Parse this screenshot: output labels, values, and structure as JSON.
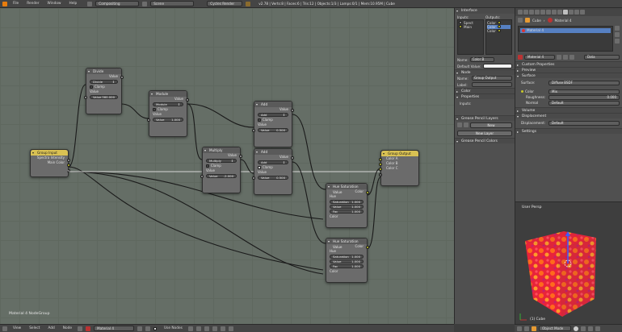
{
  "topbar": {
    "menus": [
      "File",
      "Render",
      "Window",
      "Help"
    ],
    "editor_type": "Compositing",
    "scene": "Scene",
    "engine": "Cycles Render",
    "stats": "v2.78 | Verts:8 | Faces:6 | Tris:12 | Objects:1/3 | Lamps:0/1 | Mem:10.95M | Cube"
  },
  "nodes": {
    "divide": {
      "title": "Divide",
      "output": "Value",
      "mode": "Divide",
      "clamp": "Clamp",
      "input": "Value",
      "value_label": "Value",
      "value": "360.000"
    },
    "module": {
      "title": "Module",
      "output": "Value",
      "mode": "Module",
      "clamp": "Clamp",
      "input": "Value",
      "value_label": "Value",
      "value": "1.000"
    },
    "multiply": {
      "title": "Multiply",
      "output": "Value",
      "mode": "Multiply",
      "clamp": "Clamp",
      "input": "Value",
      "value_label": "Value",
      "value": "-2.000"
    },
    "add1": {
      "title": "Add",
      "output": "Value",
      "mode": "Add",
      "clamp": "Clamp",
      "input": "Value",
      "value_label": "Value",
      "value": "0.500"
    },
    "add2": {
      "title": "Add",
      "output": "Value",
      "mode": "Add",
      "clamp": "Clamp",
      "input": "Value",
      "value_label": "Value",
      "value": "0.500"
    },
    "group_input": {
      "title": "Group Input",
      "out1": "Spectra Intensity",
      "out2": "Main Color"
    },
    "group_output": {
      "title": "Group Output",
      "in1": "Color A",
      "in2": "Color B",
      "in3": "Color C"
    },
    "hsv1": {
      "title": "Hue Saturation Value",
      "output": "Color",
      "hue": "Hue",
      "sat_label": "Saturation",
      "sat": "1.000",
      "val_label": "Value",
      "val": "1.000",
      "fac_label": "Fac",
      "fac": "1.000",
      "color": "Color"
    },
    "hsv2": {
      "title": "Hue Saturation Value",
      "output": "Color",
      "hue": "Hue",
      "sat_label": "Saturation",
      "sat": "1.000",
      "val_label": "Value",
      "val": "1.000",
      "fac_label": "Fac",
      "fac": "1.000",
      "color": "Color"
    }
  },
  "editor_label": "Material 4 NodeGroup",
  "bottombar": {
    "menus": [
      "View",
      "Select",
      "Add",
      "Node"
    ],
    "material": "Material 4",
    "use_nodes": "Use Nodes"
  },
  "sidebar": {
    "interface_title": "Interface",
    "inputs_title": "Inputs:",
    "outputs_title": "Outputs:",
    "inputs": [
      "Spect",
      "Main"
    ],
    "outputs": [
      "Color",
      "Color",
      "Color"
    ],
    "name_label": "Name:",
    "name_value": "Color B",
    "default_value_label": "Default Value:",
    "node_title": "Node",
    "node_name_label": "Name:",
    "node_name_value": "Group Output",
    "node_label_label": "Label:",
    "color_title": "Color",
    "properties_title": "Properties",
    "inputs_label": "Inputs:",
    "grease_title": "Grease Pencil Layers",
    "new_btn": "New",
    "new_layer_btn": "New Layer",
    "grease_colors_title": "Grease Pencil Colors"
  },
  "properties": {
    "breadcrumb_obj": "Cube",
    "breadcrumb_mat": "Material 4",
    "slot_name": "Material 4",
    "material_field": "Material 4",
    "data_field": "Data",
    "custom_props": "Custom Properties",
    "preview": "Preview",
    "surface_title": "Surface",
    "surface_label": "Surface:",
    "surface_value": "Diffuse BSDF",
    "color_label": "Color",
    "color_value": "Mix",
    "roughness_label": "Roughness:",
    "roughness_value": "0.000",
    "normal_label": "Normal",
    "normal_value": "Default",
    "volume": "Volume",
    "displacement_title": "Displacement",
    "displacement_label": "Displacement:",
    "displacement_value": "Default",
    "settings": "Settings"
  },
  "viewport": {
    "title": "User Persp",
    "object_label": "(1) Cube",
    "mode": "Object Mode"
  },
  "colors": {
    "group_header": "#d9c153",
    "highlight": "#5680c2",
    "grid": "#656e66"
  }
}
